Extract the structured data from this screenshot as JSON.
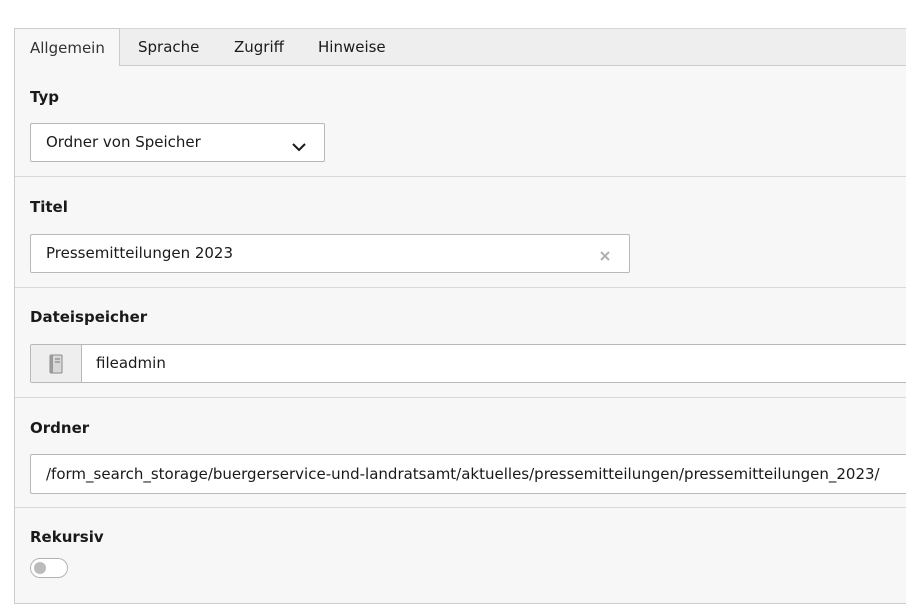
{
  "tabs": [
    {
      "label": "Allgemein",
      "active": true
    },
    {
      "label": "Sprache",
      "active": false
    },
    {
      "label": "Zugriff",
      "active": false
    },
    {
      "label": "Hinweise",
      "active": false
    }
  ],
  "fields": {
    "typ": {
      "label": "Typ",
      "selected": "Ordner von Speicher",
      "icon": "chevron-down-icon"
    },
    "titel": {
      "label": "Titel",
      "value": "Pressemitteilungen 2023",
      "icon": "clear-icon"
    },
    "dateispeicher": {
      "label": "Dateispeicher",
      "value": "fileadmin",
      "icon": "storage-icon"
    },
    "ordner": {
      "label": "Ordner",
      "value": "/form_search_storage/buergerservice-und-landratsamt/aktuelles/pressemitteilungen/pressemitteilungen_2023/"
    },
    "rekursiv": {
      "label": "Rekursiv",
      "enabled": false
    }
  },
  "colors": {
    "tab_bar": "#eeeeee",
    "panel": "#f7f7f7",
    "border": "#b8b8b8",
    "toggle_knob_off": "#bbbbbb"
  }
}
